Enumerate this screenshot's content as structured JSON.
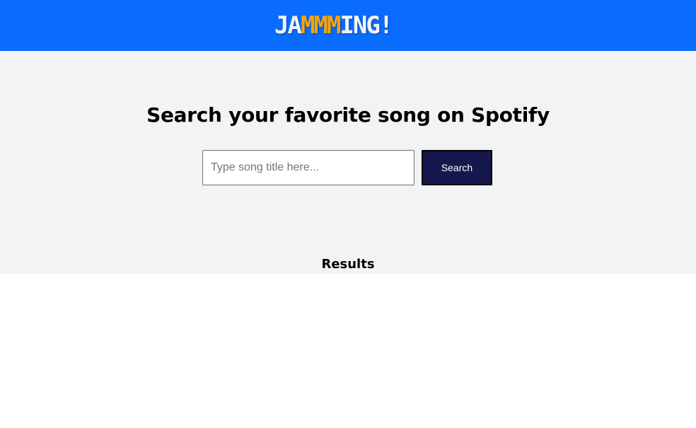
{
  "header": {
    "logo": {
      "parts": [
        "JA",
        "MMM",
        "ING!"
      ],
      "colors": {
        "white_part": "#f4f4f4",
        "orange_part": "#f5a40a"
      }
    },
    "background_color": "#0a6cff"
  },
  "hero": {
    "title": "Search your favorite song on Spotify",
    "background_color": "#f2f3f5"
  },
  "search": {
    "placeholder": "Type song title here...",
    "value": "",
    "button_label": "Search",
    "button_color": "#17174f"
  },
  "results": {
    "title": "Results",
    "items": []
  }
}
